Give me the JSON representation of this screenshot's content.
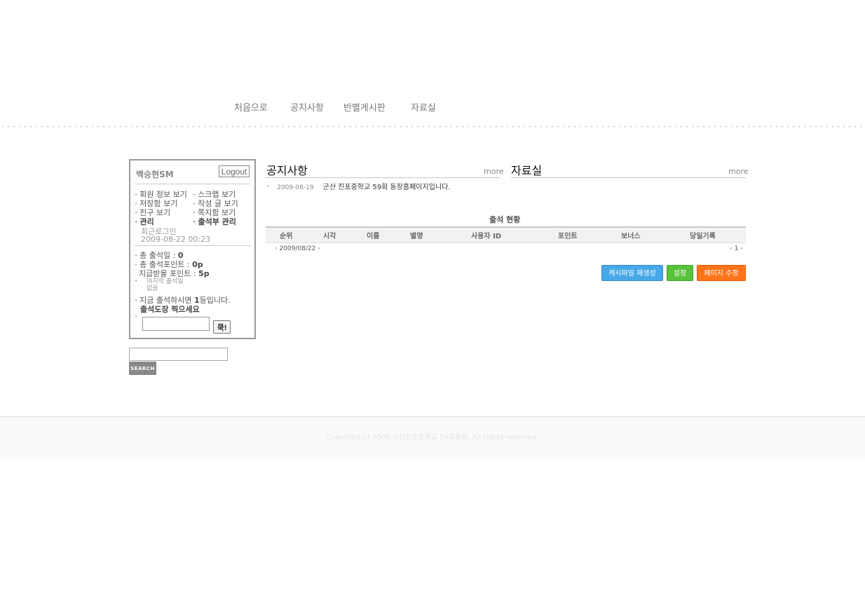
{
  "nav": {
    "items": [
      {
        "label": "처음으로"
      },
      {
        "label": "공지사항"
      },
      {
        "label": "반별게시판"
      },
      {
        "label": "자료실"
      }
    ]
  },
  "login": {
    "username": "백승현SM",
    "logout_label": "Logout",
    "links": [
      "회원 정보 보기",
      "스크랩 보기",
      "저장함 보기",
      "작성 글 보기",
      "친구 보기",
      "쪽지함 보기",
      "관리",
      "출석부 관리"
    ],
    "recent_login_label": "최근로그인",
    "recent_login_time": "2009-08-22 00:23"
  },
  "attendance_info": {
    "total_days_label": "총 출석일 :",
    "total_days_value": "0",
    "total_points_label": "총 출석포인트 :",
    "total_points_value": "0p",
    "pay_points_label": "지급받을 포인트 :",
    "pay_points_value": "5p",
    "last_attend_label": "마지막 출석일",
    "last_attend_value": "없음",
    "rank_prefix": "지금 출석하시면",
    "rank_value": "1",
    "rank_suffix": "등입니다.",
    "stamp_prompt": "출석도장 찍으세요",
    "stamp_button": "쿡!"
  },
  "search": {
    "button_label": "SEARCH"
  },
  "notice_board": {
    "title": "공지사항",
    "more": "more",
    "items": [
      {
        "date": "2009-08-19",
        "title": "군산 진포중학교 59회 동창홈페이지입니다."
      }
    ]
  },
  "files_board": {
    "title": "자료실",
    "more": "more"
  },
  "attendance_table": {
    "title": "출석 현황",
    "columns": [
      "순위",
      "시각",
      "이름",
      "별명",
      "사용자 ID",
      "포인트",
      "보너스",
      "당일기록"
    ],
    "date": "2009/08/22",
    "page": "1"
  },
  "actions": {
    "cache_label": "캐시파일 재생성",
    "settings_label": "설정",
    "edit_label": "페이지 수정"
  },
  "footer": {
    "copyright": "Copyright(c) 2009 군산진포중학교 59회동창. All rights reserved."
  },
  "colors": {
    "cache_button": "#47a8e8",
    "settings_button": "#58c23a",
    "edit_button": "#ff7418"
  }
}
